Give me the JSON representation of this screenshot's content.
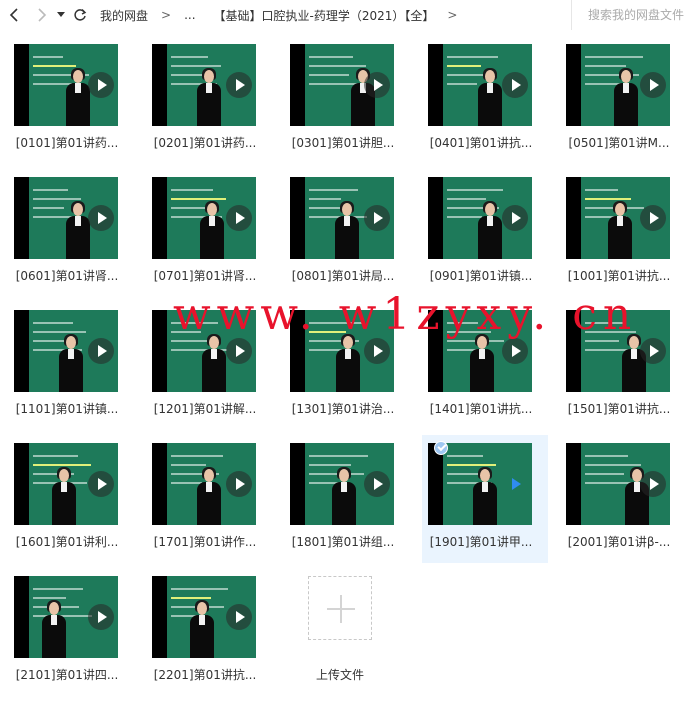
{
  "toolbar": {
    "back_icon": "chevron-left-icon",
    "forward_icon": "chevron-right-icon",
    "history_icon": "caret-down-icon",
    "refresh_icon": "refresh-icon"
  },
  "breadcrumb": {
    "root": "我的网盘",
    "separator": ">",
    "ellipsis": "...",
    "current": "【基础】口腔执业-药理学（2021）【全】"
  },
  "search": {
    "placeholder": "搜索我的网盘文件"
  },
  "files": [
    {
      "name": "[0101]第01讲药...",
      "selected": false
    },
    {
      "name": "[0201]第01讲药...",
      "selected": false
    },
    {
      "name": "[0301]第01讲胆...",
      "selected": false
    },
    {
      "name": "[0401]第01讲抗...",
      "selected": false
    },
    {
      "name": "[0501]第01讲M...",
      "selected": false
    },
    {
      "name": "[0601]第01讲肾...",
      "selected": false
    },
    {
      "name": "[0701]第01讲肾...",
      "selected": false
    },
    {
      "name": "[0801]第01讲局...",
      "selected": false
    },
    {
      "name": "[0901]第01讲镇...",
      "selected": false
    },
    {
      "name": "[1001]第01讲抗...",
      "selected": false
    },
    {
      "name": "[1101]第01讲镇...",
      "selected": false
    },
    {
      "name": "[1201]第01讲解...",
      "selected": false
    },
    {
      "name": "[1301]第01讲治...",
      "selected": false
    },
    {
      "name": "[1401]第01讲抗...",
      "selected": false
    },
    {
      "name": "[1501]第01讲抗...",
      "selected": false
    },
    {
      "name": "[1601]第01讲利...",
      "selected": false
    },
    {
      "name": "[1701]第01讲作...",
      "selected": false
    },
    {
      "name": "[1801]第01讲组...",
      "selected": false
    },
    {
      "name": "[1901]第01讲甲...",
      "selected": true
    },
    {
      "name": "[2001]第01讲β-...",
      "selected": false
    },
    {
      "name": "[2101]第01讲四...",
      "selected": false
    },
    {
      "name": "[2201]第01讲抗...",
      "selected": false
    }
  ],
  "upload": {
    "label": "上传文件",
    "icon": "plus-icon"
  },
  "watermark": "www. w1zyxy. cn",
  "colors": {
    "board": "#1e7a5a",
    "selected_bg": "#eaf4fe",
    "watermark": "#e8132c",
    "play_active": "#2f8cf0"
  }
}
